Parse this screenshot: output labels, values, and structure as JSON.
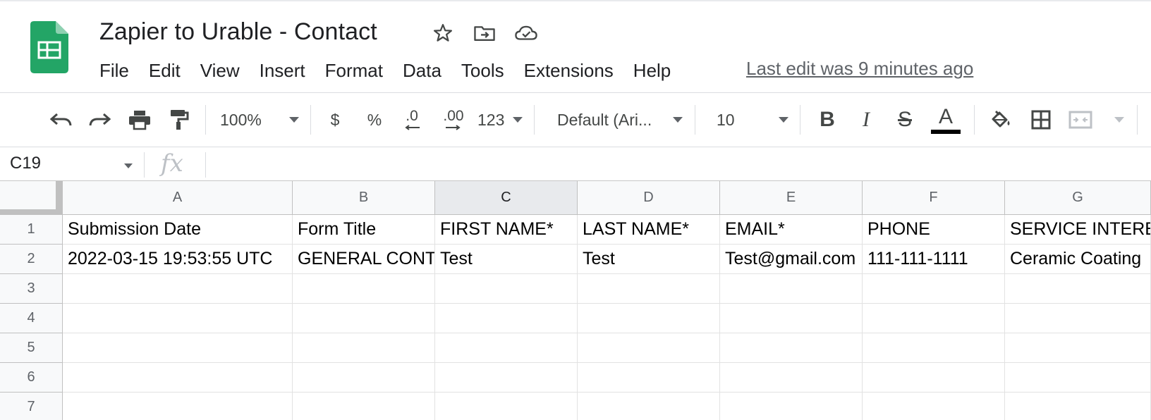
{
  "document": {
    "title": "Zapier to Urable - Contact",
    "last_edit": "Last edit was 9 minutes ago"
  },
  "title_icons": {
    "star": "star-icon",
    "move": "folder-move-icon",
    "cloud": "cloud-saved-icon"
  },
  "menu": [
    "File",
    "Edit",
    "View",
    "Insert",
    "Format",
    "Data",
    "Tools",
    "Extensions",
    "Help"
  ],
  "toolbar": {
    "zoom": "100%",
    "currency": "$",
    "percent": "%",
    "decrease_decimal": ".0",
    "increase_decimal": ".00",
    "more_formats": "123",
    "font": "Default (Ari...",
    "font_size": "10",
    "bold": "B",
    "italic": "I",
    "strikethrough": "S",
    "text_color": "A"
  },
  "formula_bar": {
    "name_box": "C19",
    "fx": "fx",
    "value": ""
  },
  "grid": {
    "columns": [
      "A",
      "B",
      "C",
      "D",
      "E",
      "F",
      "G"
    ],
    "selected_column": "C",
    "rows": [
      "1",
      "2",
      "3",
      "4",
      "5",
      "6",
      "7"
    ],
    "cells": [
      [
        "Submission Date",
        "Form Title",
        "FIRST NAME*",
        "LAST NAME*",
        "EMAIL*",
        "PHONE",
        "SERVICE INTEREST"
      ],
      [
        "2022-03-15 19:53:55 UTC",
        "GENERAL CONTACT",
        "Test",
        "Test",
        "Test@gmail.com",
        "111-111-1111",
        "Ceramic Coating"
      ],
      [
        "",
        "",
        "",
        "",
        "",
        "",
        ""
      ],
      [
        "",
        "",
        "",
        "",
        "",
        "",
        ""
      ],
      [
        "",
        "",
        "",
        "",
        "",
        "",
        ""
      ],
      [
        "",
        "",
        "",
        "",
        "",
        "",
        ""
      ],
      [
        "",
        "",
        "",
        "",
        "",
        "",
        ""
      ]
    ]
  },
  "colors": {
    "sheets_green": "#23a566",
    "text_color_bar": "#000000",
    "header_bg": "#f8f9fa",
    "selected_header_bg": "#e8eaed"
  }
}
